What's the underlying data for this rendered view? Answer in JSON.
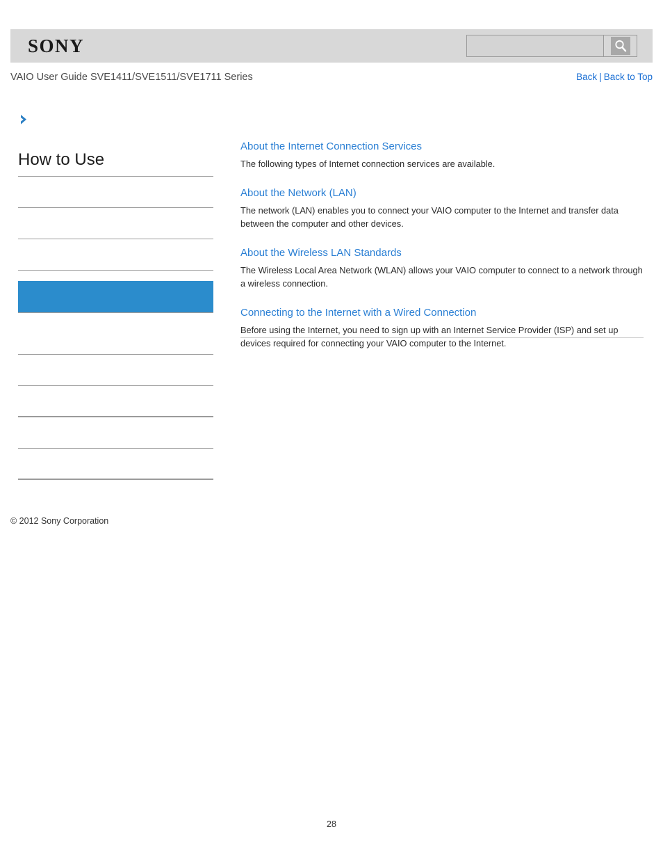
{
  "header": {
    "logo": "SONY",
    "doc_title": "VAIO User Guide SVE1411/SVE1511/SVE1711 Series",
    "search": {
      "value": "",
      "placeholder": "",
      "button_icon": "search-icon"
    },
    "nav": {
      "back": "Back",
      "separator": "|",
      "back_to_top": "Back to Top"
    }
  },
  "sidebar": {
    "arrow_icon": "chevron-right-icon",
    "heading": "How to Use",
    "items": [
      {
        "label": "",
        "active": false,
        "thick": false
      },
      {
        "label": "",
        "active": false,
        "thick": false
      },
      {
        "label": "",
        "active": false,
        "thick": false
      },
      {
        "label": "",
        "active": true,
        "thick": false
      },
      {
        "label": "",
        "active": false,
        "thick": false
      },
      {
        "label": "",
        "active": false,
        "thick": false
      },
      {
        "label": "",
        "active": false,
        "thick": true
      },
      {
        "label": "",
        "active": false,
        "thick": false
      },
      {
        "label": "",
        "active": false,
        "thick": true
      }
    ],
    "copyright": "© 2012 Sony Corporation"
  },
  "content": {
    "entries": [
      {
        "title": "About the Internet Connection Services",
        "description": "The following types of Internet connection services are available."
      },
      {
        "title": "About the Network (LAN)",
        "description": "The network (LAN) enables you to connect your VAIO computer to the Internet and transfer data between the computer and other devices."
      },
      {
        "title": "About the Wireless LAN Standards",
        "description": "The Wireless Local Area Network (WLAN) allows your VAIO computer to connect to a network through a wireless connection."
      },
      {
        "title": "Connecting to the Internet with a Wired Connection",
        "description": "Before using the Internet, you need to sign up with an Internet Service Provider (ISP) and set up devices required for connecting your VAIO computer to the Internet."
      }
    ]
  },
  "footer": {
    "page_number": "28"
  },
  "colors": {
    "link": "#1a6fd4",
    "content_link": "#2a7fd4",
    "active_highlight": "#2b8ccc",
    "header_bar": "#d8d8d8",
    "rule": "#9b9b9b"
  }
}
